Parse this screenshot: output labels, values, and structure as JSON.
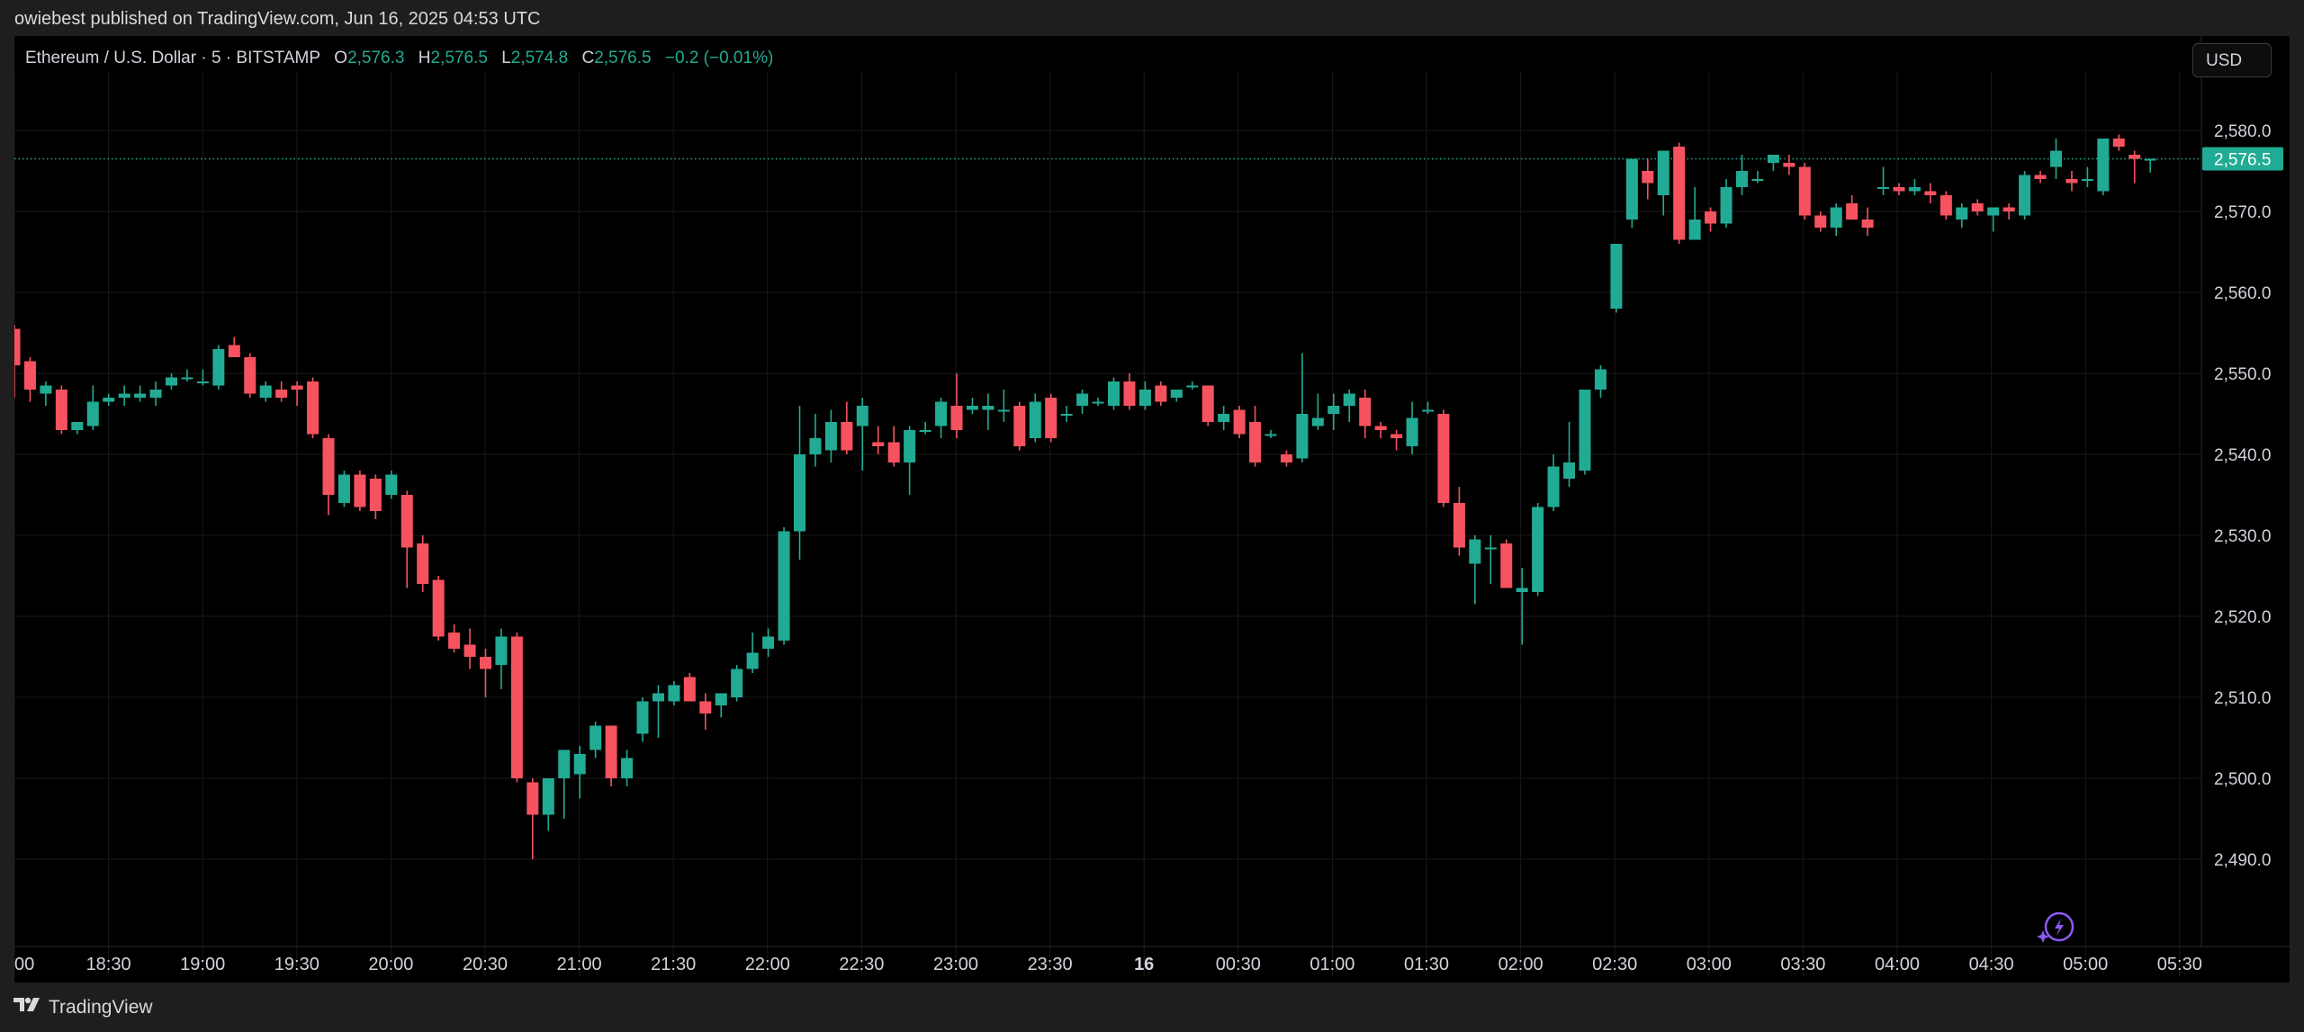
{
  "header": {
    "published_text": "owiebest published on TradingView.com, Jun 16, 2025 04:53 UTC"
  },
  "legend": {
    "symbol": "Ethereum / U.S. Dollar · 5 · BITSTAMP",
    "o_label": "O",
    "o_value": "2,576.3",
    "h_label": "H",
    "h_value": "2,576.5",
    "l_label": "L",
    "l_value": "2,574.8",
    "c_label": "C",
    "c_value": "2,576.5",
    "change": "−0.2 (−0.01%)"
  },
  "currency_button": "USD",
  "footer": {
    "brand": "TradingView"
  },
  "icons": {
    "logo": "tradingview-logo-icon",
    "snapshot": "sparkle-lightning-icon"
  },
  "colors": {
    "up": "#22ab94",
    "down": "#f7525f",
    "background": "#000000",
    "grid": "#1a1a1a",
    "axis_text": "#d1d4dc",
    "price_line": "#22ab94"
  },
  "chart_data": {
    "type": "candlestick",
    "interval": "5",
    "ylim": [
      2480,
      2585
    ],
    "y_ticks": [
      2490,
      2500,
      2510,
      2520,
      2530,
      2540,
      2550,
      2560,
      2570,
      2580
    ],
    "y_tick_labels": [
      "2,490.0",
      "2,500.0",
      "2,510.0",
      "2,520.0",
      "2,530.0",
      "2,540.0",
      "2,550.0",
      "2,560.0",
      "2,570.0",
      "2,580.0"
    ],
    "x_tick_labels": [
      "00",
      "18:30",
      "19:00",
      "19:30",
      "20:00",
      "20:30",
      "21:00",
      "21:30",
      "22:00",
      "22:30",
      "23:00",
      "23:30",
      "16",
      "00:30",
      "01:00",
      "01:30",
      "02:00",
      "02:30",
      "03:00",
      "03:30",
      "04:00",
      "04:30",
      "05:00",
      "05:30"
    ],
    "x_tick_bold": [
      "16"
    ],
    "last_price": 2576.5,
    "last_price_label": "2,576.5",
    "candles": [
      [
        2555.5,
        2556.0,
        2547.0,
        2551.0
      ],
      [
        2551.5,
        2552.0,
        2546.5,
        2548.0
      ],
      [
        2547.5,
        2549.0,
        2546.0,
        2548.5
      ],
      [
        2548.0,
        2548.5,
        2542.5,
        2543.0
      ],
      [
        2543.0,
        2544.0,
        2542.5,
        2544.0
      ],
      [
        2543.5,
        2548.5,
        2543.0,
        2546.5
      ],
      [
        2546.5,
        2547.5,
        2546.0,
        2547.0
      ],
      [
        2547.0,
        2548.5,
        2546.0,
        2547.5
      ],
      [
        2547.0,
        2548.5,
        2546.5,
        2547.5
      ],
      [
        2547.0,
        2549.0,
        2546.0,
        2548.0
      ],
      [
        2548.5,
        2550.0,
        2548.0,
        2549.5
      ],
      [
        2549.5,
        2550.5,
        2549.0,
        2549.5
      ],
      [
        2549.0,
        2550.5,
        2548.5,
        2549.0
      ],
      [
        2548.5,
        2553.5,
        2548.0,
        2553.0
      ],
      [
        2553.5,
        2554.5,
        2552.0,
        2552.0
      ],
      [
        2552.0,
        2552.5,
        2547.0,
        2547.5
      ],
      [
        2547.0,
        2549.0,
        2546.5,
        2548.5
      ],
      [
        2548.0,
        2549.0,
        2546.5,
        2547.0
      ],
      [
        2548.5,
        2549.0,
        2546.0,
        2548.0
      ],
      [
        2549.0,
        2549.5,
        2542.0,
        2542.5
      ],
      [
        2542.0,
        2542.5,
        2532.5,
        2535.0
      ],
      [
        2534.0,
        2538.0,
        2533.5,
        2537.5
      ],
      [
        2537.5,
        2538.0,
        2533.0,
        2533.5
      ],
      [
        2537.0,
        2537.5,
        2532.0,
        2533.0
      ],
      [
        2535.0,
        2538.0,
        2534.5,
        2537.5
      ],
      [
        2535.0,
        2535.5,
        2523.5,
        2528.5
      ],
      [
        2529.0,
        2530.0,
        2523.0,
        2524.0
      ],
      [
        2524.5,
        2525.0,
        2517.0,
        2517.5
      ],
      [
        2518.0,
        2519.0,
        2515.5,
        2516.0
      ],
      [
        2516.5,
        2518.5,
        2513.5,
        2515.0
      ],
      [
        2515.0,
        2516.0,
        2510.0,
        2513.5
      ],
      [
        2514.0,
        2518.5,
        2511.0,
        2517.5
      ],
      [
        2517.5,
        2518.0,
        2499.5,
        2500.0
      ],
      [
        2499.5,
        2500.0,
        2490.0,
        2495.5
      ],
      [
        2495.5,
        2500.0,
        2493.5,
        2500.0
      ],
      [
        2500.0,
        2503.5,
        2495.0,
        2503.5
      ],
      [
        2500.5,
        2504.0,
        2497.5,
        2503.0
      ],
      [
        2503.5,
        2507.0,
        2502.5,
        2506.5
      ],
      [
        2506.5,
        2506.5,
        2499.0,
        2500.0
      ],
      [
        2500.0,
        2503.5,
        2499.0,
        2502.5
      ],
      [
        2505.5,
        2510.0,
        2504.5,
        2509.5
      ],
      [
        2509.5,
        2511.5,
        2505.0,
        2510.5
      ],
      [
        2509.5,
        2512.0,
        2509.0,
        2511.5
      ],
      [
        2512.5,
        2513.0,
        2509.5,
        2509.5
      ],
      [
        2509.5,
        2510.5,
        2506.0,
        2508.0
      ],
      [
        2509.0,
        2510.0,
        2507.5,
        2510.5
      ],
      [
        2510.0,
        2514.0,
        2509.5,
        2513.5
      ],
      [
        2513.5,
        2518.0,
        2513.0,
        2515.5
      ],
      [
        2516.0,
        2518.5,
        2515.0,
        2517.5
      ],
      [
        2517.0,
        2531.0,
        2516.5,
        2530.5
      ],
      [
        2530.5,
        2546.0,
        2527.0,
        2540.0
      ],
      [
        2540.0,
        2545.0,
        2538.5,
        2542.0
      ],
      [
        2540.5,
        2545.5,
        2539.0,
        2544.0
      ],
      [
        2544.0,
        2546.5,
        2540.0,
        2540.5
      ],
      [
        2543.5,
        2547.0,
        2538.0,
        2546.0
      ],
      [
        2541.5,
        2543.5,
        2540.0,
        2541.0
      ],
      [
        2541.5,
        2543.5,
        2538.5,
        2539.0
      ],
      [
        2539.0,
        2543.5,
        2535.0,
        2543.0
      ],
      [
        2543.0,
        2544.0,
        2542.5,
        2543.0
      ],
      [
        2543.5,
        2547.0,
        2542.0,
        2546.5
      ],
      [
        2546.0,
        2550.0,
        2542.0,
        2543.0
      ],
      [
        2545.5,
        2547.0,
        2545.0,
        2546.0
      ],
      [
        2545.5,
        2547.5,
        2543.0,
        2546.0
      ],
      [
        2545.5,
        2548.0,
        2544.0,
        2545.5
      ],
      [
        2546.0,
        2546.5,
        2540.5,
        2541.0
      ],
      [
        2542.0,
        2547.5,
        2541.5,
        2546.5
      ],
      [
        2547.0,
        2547.5,
        2541.5,
        2542.0
      ],
      [
        2545.0,
        2546.0,
        2544.0,
        2545.0
      ],
      [
        2546.0,
        2548.0,
        2545.0,
        2547.5
      ],
      [
        2546.5,
        2547.0,
        2546.0,
        2546.5
      ],
      [
        2546.0,
        2549.5,
        2545.5,
        2549.0
      ],
      [
        2549.0,
        2550.0,
        2545.5,
        2546.0
      ],
      [
        2546.0,
        2549.0,
        2545.5,
        2548.0
      ],
      [
        2548.5,
        2549.0,
        2546.0,
        2546.5
      ],
      [
        2547.0,
        2548.0,
        2546.5,
        2548.0
      ],
      [
        2548.5,
        2549.0,
        2548.0,
        2548.5
      ],
      [
        2548.5,
        2548.5,
        2543.5,
        2544.0
      ],
      [
        2544.0,
        2546.0,
        2543.0,
        2545.0
      ],
      [
        2545.5,
        2546.0,
        2542.0,
        2542.5
      ],
      [
        2544.0,
        2546.0,
        2538.5,
        2539.0
      ],
      [
        2542.5,
        2543.0,
        2542.0,
        2542.5
      ],
      [
        2540.0,
        2540.5,
        2538.5,
        2539.0
      ],
      [
        2539.5,
        2552.5,
        2539.0,
        2545.0
      ],
      [
        2543.5,
        2547.5,
        2543.0,
        2544.5
      ],
      [
        2545.0,
        2547.5,
        2543.0,
        2546.0
      ],
      [
        2546.0,
        2548.0,
        2544.0,
        2547.5
      ],
      [
        2547.0,
        2548.0,
        2542.0,
        2543.5
      ],
      [
        2543.5,
        2544.0,
        2542.0,
        2543.0
      ],
      [
        2542.5,
        2543.0,
        2540.5,
        2542.0
      ],
      [
        2541.0,
        2546.5,
        2540.0,
        2544.5
      ],
      [
        2545.5,
        2546.5,
        2545.0,
        2545.5
      ],
      [
        2545.0,
        2545.5,
        2533.5,
        2534.0
      ],
      [
        2534.0,
        2536.0,
        2527.5,
        2528.5
      ],
      [
        2526.5,
        2530.0,
        2521.5,
        2529.5
      ],
      [
        2528.5,
        2530.0,
        2524.0,
        2528.5
      ],
      [
        2529.0,
        2529.5,
        2523.5,
        2523.5
      ],
      [
        2523.0,
        2526.0,
        2516.5,
        2523.5
      ],
      [
        2523.0,
        2534.0,
        2522.5,
        2533.5
      ],
      [
        2533.5,
        2540.0,
        2533.0,
        2538.5
      ],
      [
        2537.0,
        2544.0,
        2536.0,
        2539.0
      ],
      [
        2538.0,
        2548.0,
        2537.5,
        2548.0
      ],
      [
        2548.0,
        2551.0,
        2547.0,
        2550.5
      ],
      [
        2558.0,
        2565.0,
        2557.5,
        2566.0
      ],
      [
        2569.0,
        2575.5,
        2568.0,
        2576.5
      ],
      [
        2575.0,
        2576.5,
        2571.5,
        2573.5
      ],
      [
        2572.0,
        2577.0,
        2569.5,
        2577.5
      ],
      [
        2578.0,
        2578.5,
        2566.0,
        2566.5
      ],
      [
        2566.5,
        2573.0,
        2566.5,
        2569.0
      ],
      [
        2570.0,
        2570.5,
        2567.5,
        2568.5
      ],
      [
        2568.5,
        2574.0,
        2568.0,
        2573.0
      ],
      [
        2573.0,
        2577.0,
        2572.0,
        2575.0
      ],
      [
        2574.0,
        2575.0,
        2573.5,
        2574.0
      ],
      [
        2576.0,
        2577.0,
        2575.0,
        2577.0
      ],
      [
        2576.0,
        2577.0,
        2574.5,
        2575.5
      ],
      [
        2575.5,
        2576.0,
        2569.0,
        2569.5
      ],
      [
        2569.5,
        2570.0,
        2567.5,
        2568.0
      ],
      [
        2568.0,
        2571.0,
        2567.0,
        2570.5
      ],
      [
        2571.0,
        2572.0,
        2570.0,
        2569.0
      ],
      [
        2569.0,
        2570.5,
        2567.0,
        2568.0
      ],
      [
        2573.0,
        2575.5,
        2572.0,
        2573.0
      ],
      [
        2573.0,
        2573.5,
        2572.0,
        2572.5
      ],
      [
        2572.5,
        2574.0,
        2572.0,
        2573.0
      ],
      [
        2572.5,
        2573.5,
        2571.0,
        2572.0
      ],
      [
        2572.0,
        2572.5,
        2569.0,
        2569.5
      ],
      [
        2569.0,
        2571.0,
        2568.0,
        2570.5
      ],
      [
        2571.0,
        2571.5,
        2569.5,
        2570.0
      ],
      [
        2569.5,
        2570.0,
        2567.5,
        2570.5
      ],
      [
        2570.5,
        2571.0,
        2569.0,
        2570.0
      ],
      [
        2569.5,
        2575.0,
        2569.0,
        2574.5
      ],
      [
        2574.5,
        2575.0,
        2573.5,
        2574.0
      ],
      [
        2575.5,
        2579.0,
        2574.0,
        2577.5
      ],
      [
        2574.0,
        2575.0,
        2572.5,
        2573.5
      ],
      [
        2574.0,
        2575.5,
        2573.0,
        2574.0
      ],
      [
        2572.5,
        2575.5,
        2572.0,
        2579.0
      ],
      [
        2579.0,
        2579.5,
        2577.5,
        2578.0
      ],
      [
        2577.0,
        2577.5,
        2573.5,
        2576.5
      ],
      [
        2576.3,
        2576.5,
        2574.8,
        2576.5
      ]
    ]
  }
}
